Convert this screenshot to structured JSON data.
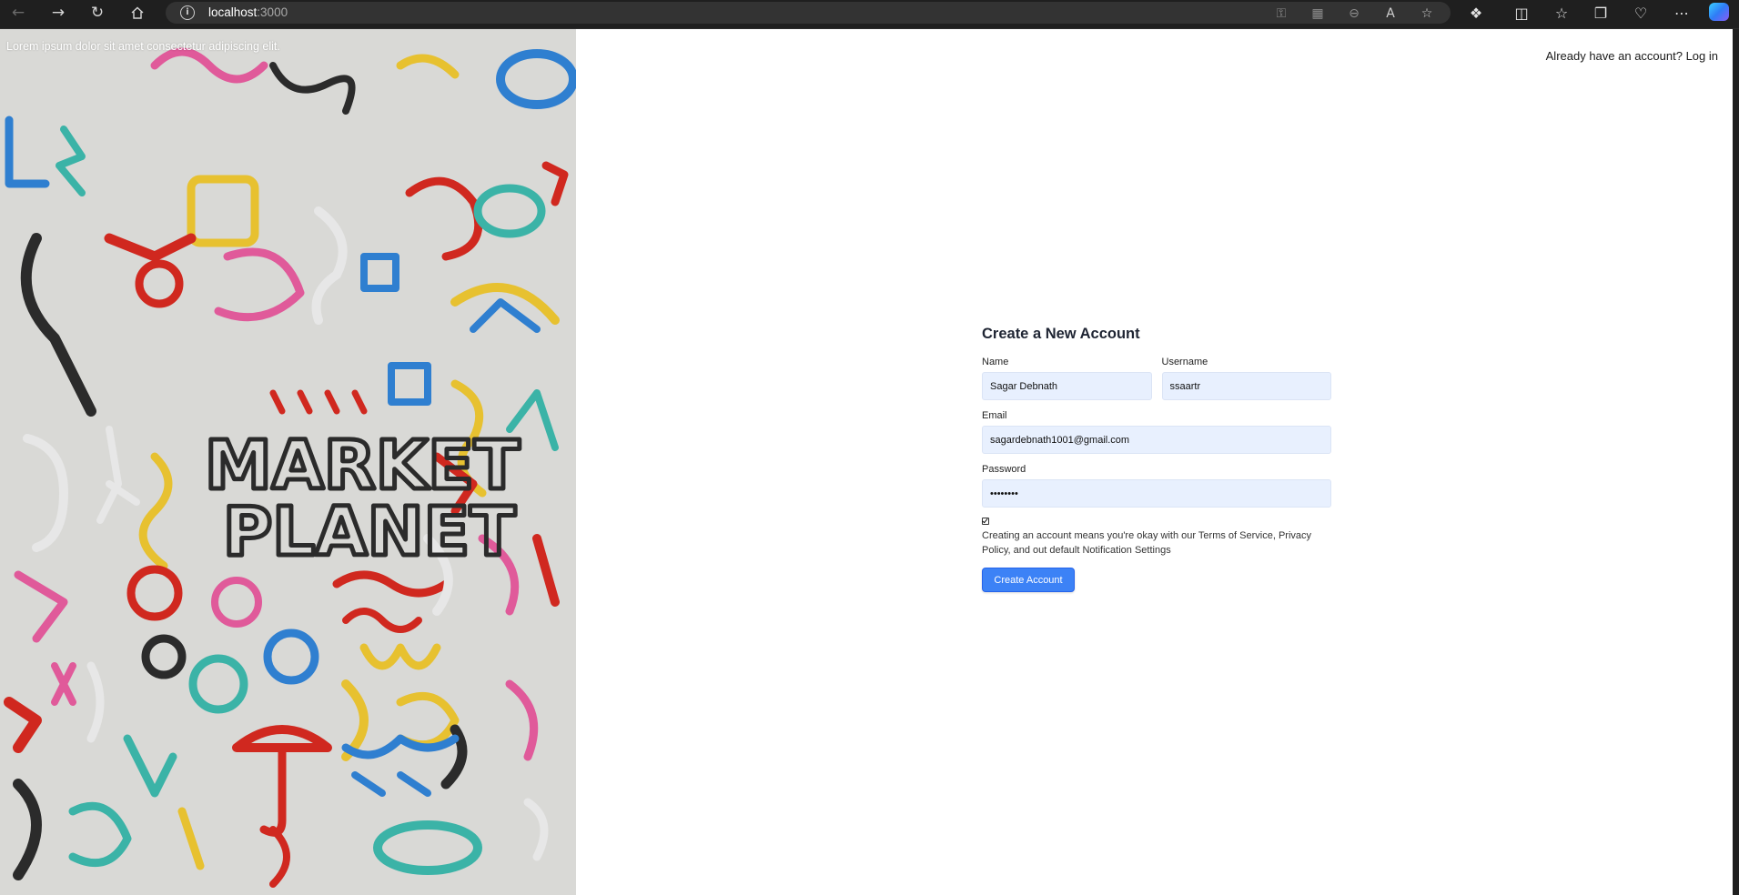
{
  "browser": {
    "url_host": "localhost",
    "url_port": ":3000",
    "icons": [
      "back-icon",
      "forward-icon",
      "refresh-icon",
      "home-icon",
      "site-info-icon",
      "key-icon",
      "app-available-icon",
      "zoom-out-icon",
      "read-aloud-icon",
      "favorite-star-icon",
      "extensions-icon",
      "split-screen-icon",
      "favorites-icon",
      "collections-icon",
      "browser-essentials-icon",
      "more-icon",
      "copilot-icon"
    ]
  },
  "hero": {
    "caption": "Lorem ipsum dolor sit amet consectetur adipiscing elit.",
    "graffiti_text": [
      "MARKET",
      "PLANET"
    ]
  },
  "header": {
    "login_prompt": "Already have an account? Log in"
  },
  "form": {
    "title": "Create a New Account",
    "name_label": "Name",
    "name_value": "Sagar Debnath",
    "username_label": "Username",
    "username_value": "ssaartr",
    "email_label": "Email",
    "email_value": "sagardebnath1001@gmail.com",
    "password_label": "Password",
    "password_value": "••••••••",
    "terms_checked": true,
    "terms_text": "Creating an account means you're okay with our Terms of Service, Privacy Policy, and out default Notification Settings",
    "submit_label": "Create Account"
  },
  "colors": {
    "chrome": "#1f1f1f",
    "input_bg": "#e8f0fe",
    "accent": "#3c82f6"
  }
}
